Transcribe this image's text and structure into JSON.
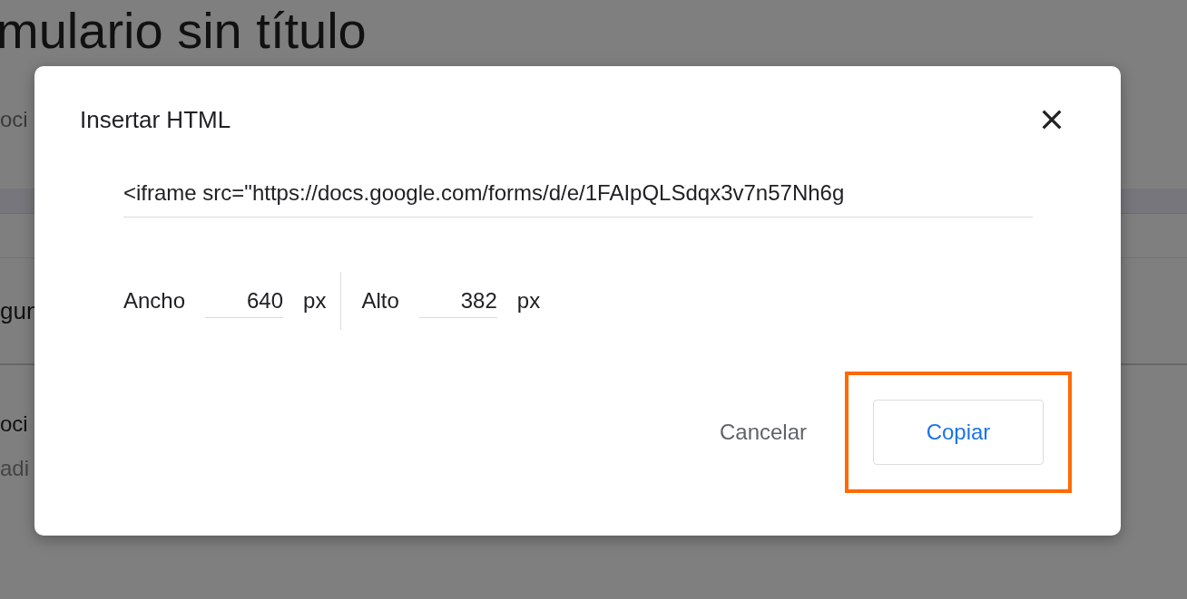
{
  "background": {
    "title": "mulario sin título",
    "texts": [
      "oci",
      "gun",
      "oci",
      "adi"
    ]
  },
  "dialog": {
    "title": "Insertar HTML",
    "embed_code": "<iframe src=\"https://docs.google.com/forms/d/e/1FAIpQLSdqx3v7n57Nh6g",
    "width": {
      "label": "Ancho",
      "value": "640",
      "unit": "px"
    },
    "height": {
      "label": "Alto",
      "value": "382",
      "unit": "px"
    },
    "buttons": [
      {
        "label": "Cancelar",
        "kind": "text",
        "highlighted": false
      },
      {
        "label": "Copiar",
        "kind": "outlined",
        "highlighted": true
      }
    ]
  }
}
